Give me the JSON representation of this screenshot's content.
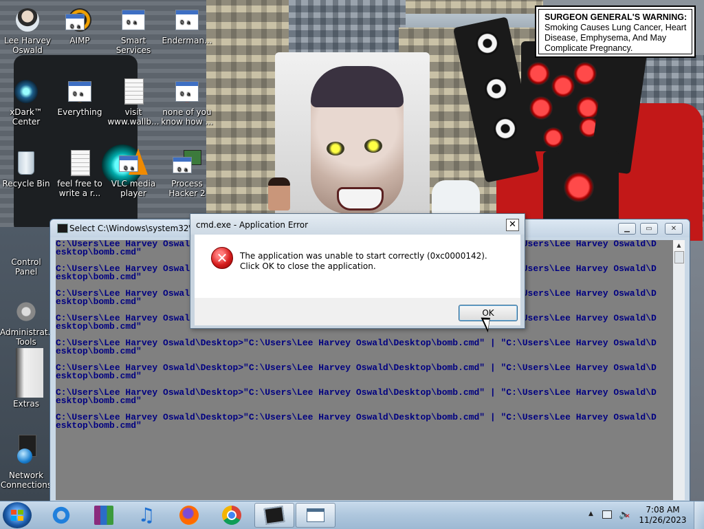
{
  "warning_label": {
    "heading": "SURGEON GENERAL'S WARNING:",
    "text": "Smoking Causes Lung Cancer, Heart Disease, Emphysema, And May Complicate Pregnancy."
  },
  "desktop_icons": [
    {
      "label": "Lee Harvey Oswald",
      "icon": "user-folder-icon"
    },
    {
      "label": "AIMP",
      "icon": "app-icon"
    },
    {
      "label": "Smart Services",
      "icon": "app-icon"
    },
    {
      "label": "Enderman...",
      "icon": "app-icon"
    },
    {
      "label": "xDark™ Center",
      "icon": "xdark-icon"
    },
    {
      "label": "Everything",
      "icon": "app-icon"
    },
    {
      "label": "visit www.wallb...",
      "icon": "document-icon"
    },
    {
      "label": "none of you know how ...",
      "icon": "app-icon"
    },
    {
      "label": "Recycle Bin",
      "icon": "recycle-bin-icon"
    },
    {
      "label": "feel free to write a r...",
      "icon": "document-icon"
    },
    {
      "label": "VLC media player",
      "icon": "app-icon"
    },
    {
      "label": "Process Hacker 2",
      "icon": "app-icon"
    },
    {
      "label": "Control Panel",
      "icon": "control-panel-icon"
    },
    {
      "label": "Administrat... Tools",
      "icon": "admin-tools-icon"
    },
    {
      "label": "Extras",
      "icon": "folder-icon"
    },
    {
      "label": "Network Connections",
      "icon": "network-icon"
    }
  ],
  "cmd_window": {
    "title": "Select C:\\Windows\\system32\\cmd.exe",
    "lines": [
      "C:\\Users\\Lee Harvey Oswald\\Desktop>\"C:\\Users\\Lee Harvey Oswald\\Desktop\\bomb.cmd\" | \"C:\\Users\\Lee Harvey Oswald\\D",
      "esktop\\bomb.cmd\"",
      "",
      "C:\\Users\\Lee Harvey Oswald\\Desktop>\"C:\\Users\\Lee Harvey Oswald\\Desktop\\bomb.cmd\" | \"C:\\Users\\Lee Harvey Oswald\\D",
      "esktop\\bomb.cmd\"",
      "",
      "C:\\Users\\Lee Harvey Oswald\\Desktop>\"C:\\Users\\Lee Harvey Oswald\\Desktop\\bomb.cmd\" | \"C:\\Users\\Lee Harvey Oswald\\D",
      "esktop\\bomb.cmd\"",
      "",
      "C:\\Users\\Lee Harvey Oswald\\Desktop>\"C:\\Users\\Lee Harvey Oswald\\Desktop\\bomb.cmd\" | \"C:\\Users\\Lee Harvey Oswald\\D",
      "esktop\\bomb.cmd\"",
      "",
      "C:\\Users\\Lee Harvey Oswald\\Desktop>\"C:\\Users\\Lee Harvey Oswald\\Desktop\\bomb.cmd\" | \"C:\\Users\\Lee Harvey Oswald\\D",
      "esktop\\bomb.cmd\"",
      "",
      "C:\\Users\\Lee Harvey Oswald\\Desktop>\"C:\\Users\\Lee Harvey Oswald\\Desktop\\bomb.cmd\" | \"C:\\Users\\Lee Harvey Oswald\\D",
      "esktop\\bomb.cmd\"",
      "",
      "C:\\Users\\Lee Harvey Oswald\\Desktop>\"C:\\Users\\Lee Harvey Oswald\\Desktop\\bomb.cmd\" | \"C:\\Users\\Lee Harvey Oswald\\D",
      "esktop\\bomb.cmd\"",
      "",
      "C:\\Users\\Lee Harvey Oswald\\Desktop>\"C:\\Users\\Lee Harvey Oswald\\Desktop\\bomb.cmd\" | \"C:\\Users\\Lee Harvey Oswald\\D",
      "esktop\\bomb.cmd\""
    ],
    "console_bg": "#808080",
    "console_fg": "#000080"
  },
  "error_dialog": {
    "title": "cmd.exe - Application Error",
    "message": "The application was unable to start correctly (0xc0000142). Click OK to close the application.",
    "ok_label": "OK",
    "close_glyph": "✕",
    "icon": "error-icon"
  },
  "taskbar": {
    "pinned": [
      {
        "name": "internet-explorer-icon",
        "active": false
      },
      {
        "name": "winrar-icon",
        "active": false
      },
      {
        "name": "music-player-icon",
        "active": false
      },
      {
        "name": "firefox-icon",
        "active": false
      },
      {
        "name": "chrome-icon",
        "active": false
      },
      {
        "name": "cmd-app-icon",
        "active": true
      },
      {
        "name": "app-window-icon",
        "active": true
      }
    ],
    "clock_time": "7:08 AM",
    "clock_date": "11/26/2023"
  }
}
